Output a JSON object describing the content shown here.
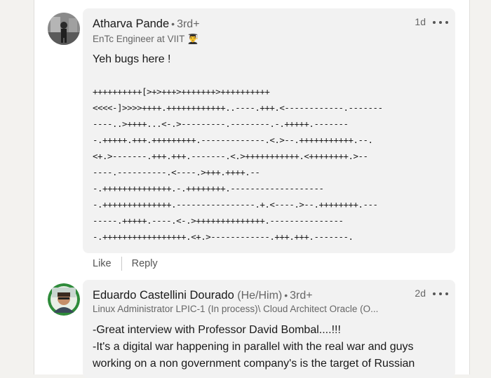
{
  "comments": [
    {
      "author": "Atharva Pande",
      "degree": "3rd+",
      "headline": "EnTc Engineer at VIIT 👨‍🎓",
      "time": "1d",
      "text": "Yeh bugs here !",
      "code": "++++++++++[>+>+++>+++++++>++++++++++\n<<<<-]>>>>++++.++++++++++++..----.+++.<------------.-------\n----..>++++...<-.>---------.--------.-.+++++.-------\n-.+++++.+++.+++++++++.-------------.<.>--.+++++++++++.--.\n<+.>-------.+++.+++.-------.<.>+++++++++++.<++++++++.>--\n----.----------.<----.>+++.++++.--\n-.++++++++++++++.-.++++++++.-------------------\n-.++++++++++++++.----------------.+.<----.>--.++++++++.---\n-----.+++++.----.<-.>++++++++++++++.---------------\n-.+++++++++++++++++.<+.>------------.+++.+++.-------.",
      "actions": {
        "like": "Like",
        "reply": "Reply"
      }
    },
    {
      "author": "Eduardo Castellini Dourado",
      "pronouns": "(He/Him)",
      "degree": "3rd+",
      "headline": "Linux Administrator LPIC-1 (In process)\\ Cloud Architect Oracle (O...",
      "time": "2d",
      "lines": [
        "-Great interview with Professor David Bombal....!!!",
        "-It's a digital war happening in parallel with the real war and guys",
        "working on a non government company's is the target of Russian"
      ]
    }
  ],
  "colors": {
    "bubble": "#f2f2f2",
    "page": "#f3f2ef",
    "muted": "#666666"
  },
  "icons": {
    "more": "more-icon"
  }
}
